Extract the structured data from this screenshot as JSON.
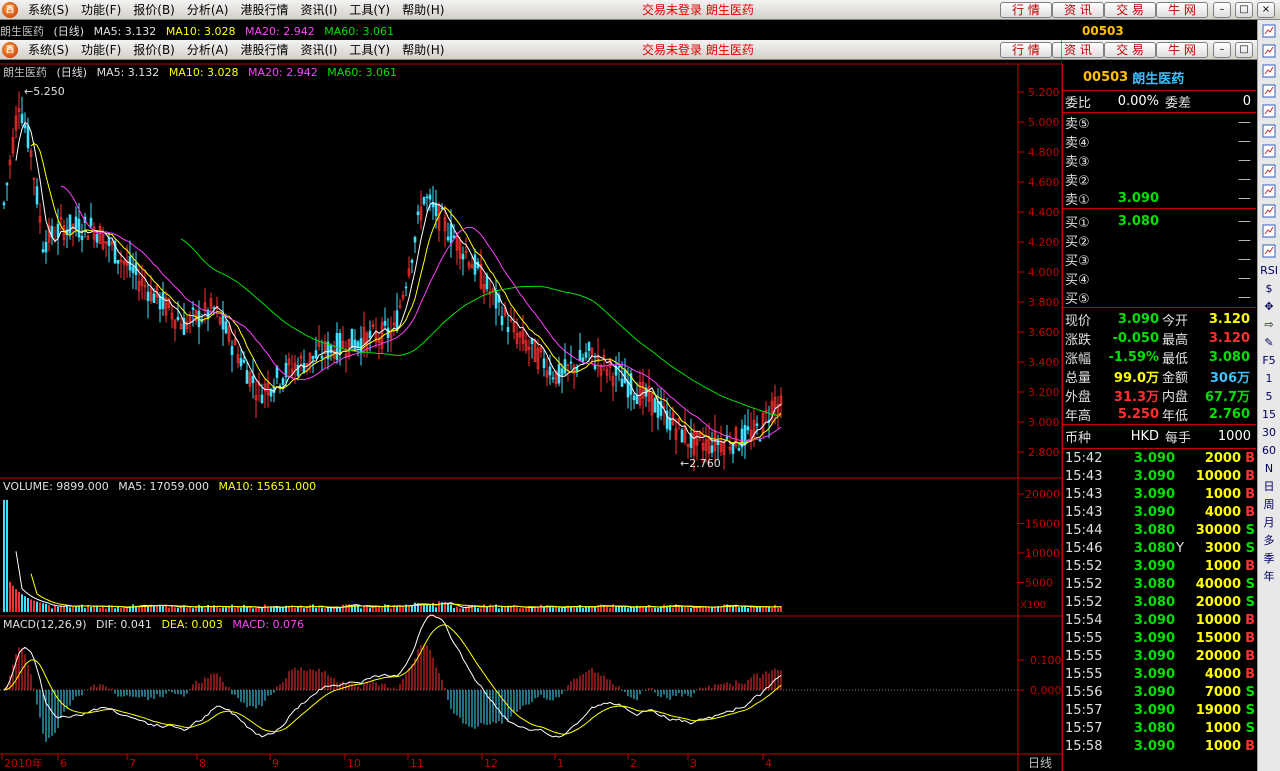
{
  "menu": {
    "logo": "西",
    "items": [
      "系统(S)",
      "功能(F)",
      "报价(B)",
      "分析(A)",
      "港股行情",
      "资讯(I)",
      "工具(Y)",
      "帮助(H)"
    ],
    "status": "交易未登录  朗生医药",
    "tabs": [
      "行 情",
      "资 讯",
      "交 易",
      "牛 网"
    ],
    "win_min": "–",
    "win_restore": "□",
    "win_close": "×"
  },
  "stock": {
    "name": "朗生医药",
    "code": "00503",
    "period": "(日线)"
  },
  "ma": {
    "ma5": "MA5: 3.132",
    "ma10": "MA10: 3.028",
    "ma20": "MA20: 2.942",
    "ma60": "MA60: 3.061"
  },
  "price_axis": [
    "5.200",
    "5.000",
    "4.800",
    "4.600",
    "4.400",
    "4.200",
    "4.000",
    "3.800",
    "3.600",
    "3.400",
    "3.200",
    "3.000",
    "2.800"
  ],
  "annotations": {
    "high": "5.250",
    "low": "2.760"
  },
  "volume": {
    "label": "VOLUME: 9899.000",
    "ma5": "MA5: 17059.000",
    "ma10": "MA10: 15651.000",
    "axis": [
      "20000",
      "15000",
      "10000",
      "5000"
    ],
    "unit": "X100"
  },
  "macd": {
    "label": "MACD(12,26,9)",
    "dif": "DIF: 0.041",
    "dea": "DEA: 0.003",
    "macd": "MACD: 0.076",
    "axis": [
      "0.100",
      "0.000"
    ]
  },
  "x_axis": [
    "2010年",
    "6",
    "7",
    "8",
    "9",
    "10",
    "11",
    "12",
    "1",
    "2",
    "3",
    "4"
  ],
  "period_label": "日线",
  "panel": {
    "weibi_label": "委比",
    "weibi": "0.00%",
    "weicha_label": "委差",
    "weicha": "0",
    "sells": [
      {
        "label": "卖⑤",
        "price": "",
        "vol": "—"
      },
      {
        "label": "卖④",
        "price": "",
        "vol": "—"
      },
      {
        "label": "卖③",
        "price": "",
        "vol": "—"
      },
      {
        "label": "卖②",
        "price": "",
        "vol": "—"
      },
      {
        "label": "卖①",
        "price": "3.090",
        "vol": "—"
      }
    ],
    "buys": [
      {
        "label": "买①",
        "price": "3.080",
        "vol": "—"
      },
      {
        "label": "买②",
        "price": "",
        "vol": "—"
      },
      {
        "label": "买③",
        "price": "",
        "vol": "—"
      },
      {
        "label": "买④",
        "price": "",
        "vol": "—"
      },
      {
        "label": "买⑤",
        "price": "",
        "vol": "—"
      }
    ],
    "quote": [
      {
        "l1": "现价",
        "v1": "3.090",
        "l2": "今开",
        "v2": "3.120"
      },
      {
        "l1": "涨跌",
        "v1": "-0.050",
        "l2": "最高",
        "v2": "3.120"
      },
      {
        "l1": "涨幅",
        "v1": "-1.59%",
        "l2": "最低",
        "v2": "3.080"
      },
      {
        "l1": "总量",
        "v1": "99.0万",
        "l2": "金额",
        "v2": "306万"
      },
      {
        "l1": "外盘",
        "v1": "31.3万",
        "l2": "内盘",
        "v2": "67.7万"
      },
      {
        "l1": "年高",
        "v1": "5.250",
        "l2": "年低",
        "v2": "2.760"
      }
    ],
    "currency_label": "币种",
    "currency": "HKD",
    "lot_label": "每手",
    "lot": "1000",
    "ticks": [
      {
        "t": "15:42",
        "p": "3.090",
        "v": "2000",
        "f": "",
        "s": "B"
      },
      {
        "t": "15:43",
        "p": "3.090",
        "v": "10000",
        "f": "",
        "s": "B"
      },
      {
        "t": "15:43",
        "p": "3.090",
        "v": "1000",
        "f": "",
        "s": "B"
      },
      {
        "t": "15:43",
        "p": "3.090",
        "v": "4000",
        "f": "",
        "s": "B"
      },
      {
        "t": "15:44",
        "p": "3.080",
        "v": "30000",
        "f": "",
        "s": "S"
      },
      {
        "t": "15:46",
        "p": "3.080",
        "v": "3000",
        "f": "Y",
        "s": "S"
      },
      {
        "t": "15:52",
        "p": "3.090",
        "v": "1000",
        "f": "",
        "s": "B"
      },
      {
        "t": "15:52",
        "p": "3.080",
        "v": "40000",
        "f": "",
        "s": "S"
      },
      {
        "t": "15:52",
        "p": "3.080",
        "v": "20000",
        "f": "",
        "s": "S"
      },
      {
        "t": "15:54",
        "p": "3.090",
        "v": "10000",
        "f": "",
        "s": "B"
      },
      {
        "t": "15:55",
        "p": "3.090",
        "v": "15000",
        "f": "",
        "s": "B"
      },
      {
        "t": "15:55",
        "p": "3.090",
        "v": "20000",
        "f": "",
        "s": "B"
      },
      {
        "t": "15:55",
        "p": "3.090",
        "v": "4000",
        "f": "",
        "s": "B"
      },
      {
        "t": "15:56",
        "p": "3.090",
        "v": "7000",
        "f": "",
        "s": "S"
      },
      {
        "t": "15:57",
        "p": "3.090",
        "v": "19000",
        "f": "",
        "s": "S"
      },
      {
        "t": "15:57",
        "p": "3.080",
        "v": "1000",
        "f": "",
        "s": "S"
      },
      {
        "t": "15:58",
        "p": "3.090",
        "v": "1000",
        "f": "",
        "s": "B"
      }
    ]
  },
  "toolbar": {
    "icons": [
      "chart-icon",
      "table-icon",
      "line-icon",
      "candle-icon",
      "list-icon",
      "fio-icon",
      "f10-icon",
      "notes-icon",
      "fiz-icon",
      "fx-icon",
      "search-icon",
      "wave-icon"
    ],
    "texts": [
      "RSI",
      "$",
      "✥",
      "⇨",
      "✎",
      "F5",
      "1",
      "5",
      "15",
      "30",
      "60",
      "N",
      "日",
      "周",
      "月",
      "多",
      "季",
      "年"
    ]
  },
  "colors": {
    "up": "#ff3030",
    "down": "#40e0ff",
    "ma5": "#ffffff",
    "ma10": "#ffff00",
    "ma20": "#ff40ff",
    "ma60": "#00e000",
    "grid": "#c00000"
  }
}
